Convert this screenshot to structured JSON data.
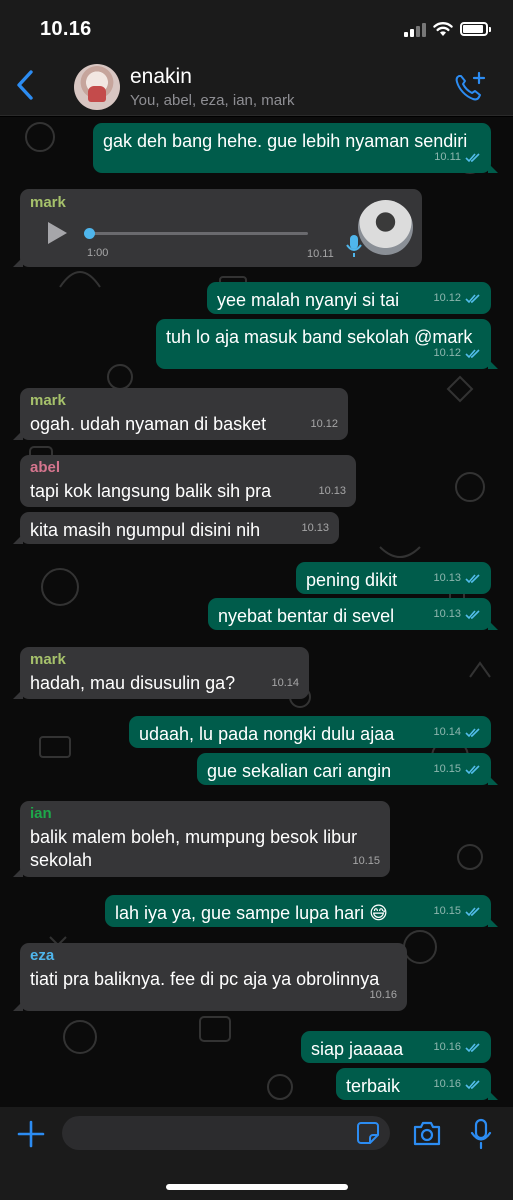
{
  "status_bar": {
    "time": "10.16"
  },
  "header": {
    "title": "enakin",
    "subtitle": "You, abel, eza, ian, mark"
  },
  "colors": {
    "accent": "#2c8cf2",
    "outgoing_bubble": "#005c4b",
    "incoming_bubble": "#363638",
    "read_ticks": "#53bdeb",
    "mark": "#a6c16b",
    "abel": "#d5758e",
    "ian": "#1ea84a",
    "eza": "#4fb6ec"
  },
  "messages": [
    {
      "direction": "out",
      "text": "gak deh bang hehe. gue lebih nyaman sendiri",
      "time": "10.11",
      "status": "read"
    },
    {
      "direction": "in",
      "type": "voice",
      "sender": "mark",
      "duration": "1:00",
      "time": "10.11",
      "progress": 0.0
    },
    {
      "direction": "out",
      "text": "yee malah nyanyi si tai",
      "time": "10.12",
      "status": "read"
    },
    {
      "direction": "out",
      "text": "tuh lo aja masuk band sekolah @mark",
      "time": "10.12",
      "status": "read"
    },
    {
      "direction": "in",
      "sender": "mark",
      "text": "ogah. udah nyaman di basket",
      "time": "10.12"
    },
    {
      "direction": "in",
      "sender": "abel",
      "text": "tapi kok langsung balik sih pra",
      "time": "10.13"
    },
    {
      "direction": "in",
      "text": "kita masih ngumpul disini nih",
      "time": "10.13"
    },
    {
      "direction": "out",
      "text": "pening dikit",
      "time": "10.13",
      "status": "read"
    },
    {
      "direction": "out",
      "text": "nyebat bentar di sevel",
      "time": "10.13",
      "status": "read"
    },
    {
      "direction": "in",
      "sender": "mark",
      "text": "hadah, mau disusulin ga?",
      "time": "10.14"
    },
    {
      "direction": "out",
      "text": "udaah, lu pada nongki dulu ajaa",
      "time": "10.14",
      "status": "read"
    },
    {
      "direction": "out",
      "text": "gue sekalian cari angin",
      "time": "10.15",
      "status": "read"
    },
    {
      "direction": "in",
      "sender": "ian",
      "text": "balik malem boleh, mumpung besok libur sekolah",
      "time": "10.15"
    },
    {
      "direction": "out",
      "text": "lah iya ya, gue sampe lupa hari 😅",
      "time": "10.15",
      "status": "read"
    },
    {
      "direction": "in",
      "sender": "eza",
      "text": "tiati pra baliknya. fee di pc aja ya obrolinnya",
      "time": "10.16"
    },
    {
      "direction": "out",
      "text": "siap jaaaaa",
      "time": "10.16",
      "status": "read"
    },
    {
      "direction": "out",
      "text": "terbaik",
      "time": "10.16",
      "status": "read"
    }
  ],
  "input": {
    "placeholder": ""
  },
  "icons": {
    "back": "chevron-left-icon",
    "call": "add-call-icon",
    "plus": "plus-icon",
    "sticker": "sticker-icon",
    "camera": "camera-icon",
    "mic": "microphone-icon"
  }
}
